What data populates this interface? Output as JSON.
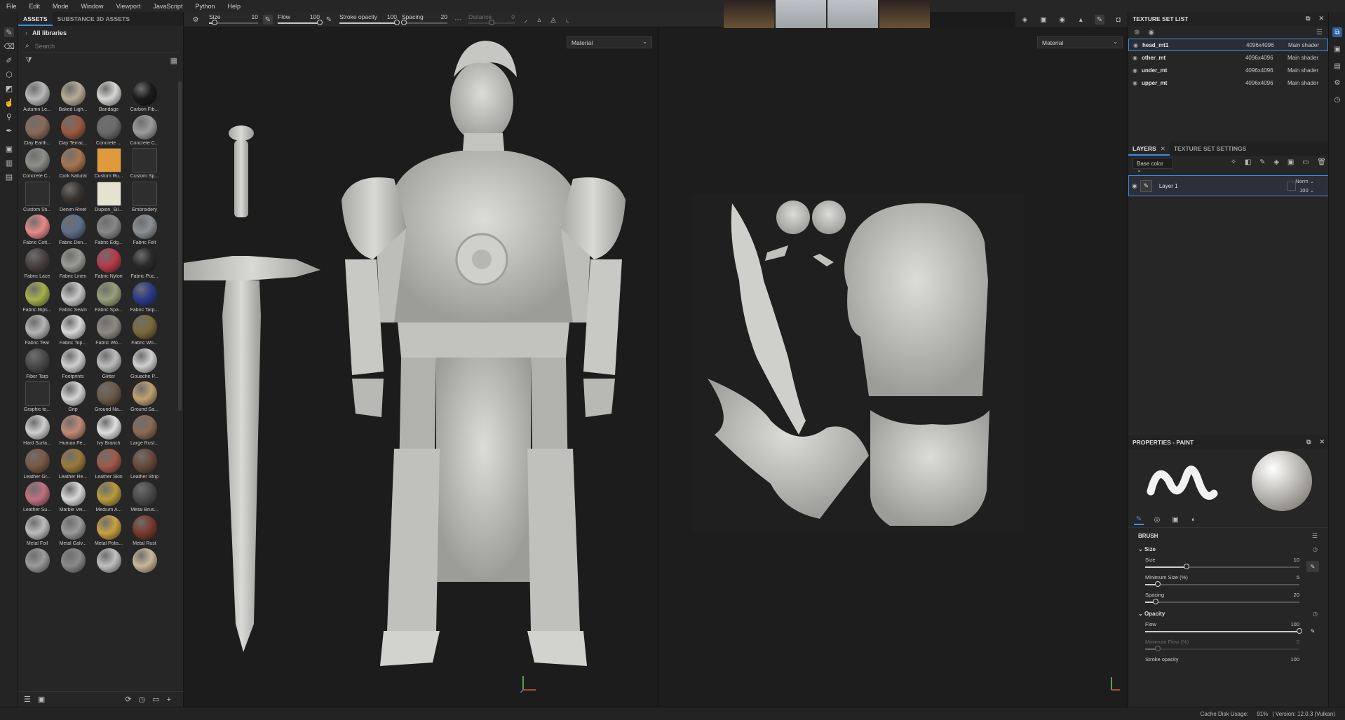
{
  "menu": [
    "File",
    "Edit",
    "Mode",
    "Window",
    "Viewport",
    "JavaScript",
    "Python",
    "Help"
  ],
  "assets": {
    "tabs": [
      "ASSETS",
      "SUBSTANCE 3D ASSETS"
    ],
    "libraries": "All libraries",
    "search_placeholder": "Search",
    "items": [
      {
        "label": "Autumn Le...",
        "color": "#b9b9b9",
        "kind": "leaf"
      },
      {
        "label": "Baked Ligh...",
        "color": "#b8ab98",
        "kind": "ball"
      },
      {
        "label": "Bandage",
        "color": "#d6d6d4",
        "kind": "ball"
      },
      {
        "label": "Carbon Fib...",
        "color": "#1a1a1a",
        "kind": "ball"
      },
      {
        "label": "Clay Earth...",
        "color": "#8a6a58",
        "kind": "ball"
      },
      {
        "label": "Clay Terrac...",
        "color": "#9a5a40",
        "kind": "ball"
      },
      {
        "label": "Concrete ...",
        "color": "#6b6b6b",
        "kind": "ball"
      },
      {
        "label": "Concrete C...",
        "color": "#9c9c9c",
        "kind": "ball"
      },
      {
        "label": "Concrete C...",
        "color": "#8e8e88",
        "kind": "ball"
      },
      {
        "label": "Cork Natural",
        "color": "#a8764f",
        "kind": "ball"
      },
      {
        "label": "Custom Ru...",
        "color": "#e09a3c",
        "kind": "tile"
      },
      {
        "label": "Custom Sp...",
        "color": "#2e2e2e",
        "kind": "tile"
      },
      {
        "label": "Custom Sti...",
        "color": "#2e2e2e",
        "kind": "tile"
      },
      {
        "label": "Denim Rivet",
        "color": "#3a3430",
        "kind": "ball"
      },
      {
        "label": "Dupion_Sil...",
        "color": "#e7e2cf",
        "kind": "tile"
      },
      {
        "label": "Embroidery",
        "color": "#2e2e2e",
        "kind": "tile"
      },
      {
        "label": "Fabric Cott...",
        "color": "#e88a8a",
        "kind": "ball"
      },
      {
        "label": "Fabric Den...",
        "color": "#5f6f88",
        "kind": "ball"
      },
      {
        "label": "Fabric Edg...",
        "color": "#888888",
        "kind": "ball"
      },
      {
        "label": "Fabric Felt",
        "color": "#8b8f96",
        "kind": "ball"
      },
      {
        "label": "Fabric Lace",
        "color": "#4a4040",
        "kind": "ball"
      },
      {
        "label": "Fabric Linen",
        "color": "#9a9a94",
        "kind": "ball"
      },
      {
        "label": "Fabric Nylon",
        "color": "#b83a4a",
        "kind": "ball"
      },
      {
        "label": "Fabric Puc...",
        "color": "#2a2a2a",
        "kind": "ball"
      },
      {
        "label": "Fabric Rips...",
        "color": "#a8b04a",
        "kind": "ball"
      },
      {
        "label": "Fabric Seam",
        "color": "#c8c8c8",
        "kind": "ball"
      },
      {
        "label": "Fabric Spa...",
        "color": "#98a07a",
        "kind": "ball"
      },
      {
        "label": "Fabric Tarp...",
        "color": "#2a3a8a",
        "kind": "ball"
      },
      {
        "label": "Fabric Tear",
        "color": "#b4b4b4",
        "kind": "ball"
      },
      {
        "label": "Fabric Top...",
        "color": "#d8d8d8",
        "kind": "ball"
      },
      {
        "label": "Fabric Wo...",
        "color": "#8e8a82",
        "kind": "ball"
      },
      {
        "label": "Fabric Wo...",
        "color": "#7a6a3a",
        "kind": "ball"
      },
      {
        "label": "Fiber Tarp",
        "color": "#4a4a4a",
        "kind": "ball"
      },
      {
        "label": "Footprints",
        "color": "#cfcfcf",
        "kind": "ball"
      },
      {
        "label": "Glitter",
        "color": "#bdbdbd",
        "kind": "ball"
      },
      {
        "label": "Gouache P...",
        "color": "#d0d0d0",
        "kind": "ball"
      },
      {
        "label": "Graphic to...",
        "color": "#2e2e2e",
        "kind": "tile"
      },
      {
        "label": "Grip",
        "color": "#d4d4d4",
        "kind": "ball"
      },
      {
        "label": "Ground Na...",
        "color": "#6a5a48",
        "kind": "ball"
      },
      {
        "label": "Ground Sa...",
        "color": "#c0a070",
        "kind": "ball"
      },
      {
        "label": "Hard Surfa...",
        "color": "#cfcfcf",
        "kind": "ball"
      },
      {
        "label": "Human Fe...",
        "color": "#c08a72",
        "kind": "ball"
      },
      {
        "label": "Ivy Branch",
        "color": "#e0e0e0",
        "kind": "ball"
      },
      {
        "label": "Large Rust...",
        "color": "#8a6a54",
        "kind": "ball"
      },
      {
        "label": "Leather Gr...",
        "color": "#7a5a44",
        "kind": "ball"
      },
      {
        "label": "Leather Re...",
        "color": "#9a7a3a",
        "kind": "ball"
      },
      {
        "label": "Leather Skin",
        "color": "#a05a48",
        "kind": "ball"
      },
      {
        "label": "Leather Strip",
        "color": "#6a4a3a",
        "kind": "ball"
      },
      {
        "label": "Leather Su...",
        "color": "#c07080",
        "kind": "ball"
      },
      {
        "label": "Marble Vei...",
        "color": "#d8d8d8",
        "kind": "ball"
      },
      {
        "label": "Medium A...",
        "color": "#b89a3a",
        "kind": "ball"
      },
      {
        "label": "Metal Brus...",
        "color": "#4a4a4a",
        "kind": "ball"
      },
      {
        "label": "Metal Foil",
        "color": "#bcbcbc",
        "kind": "ball"
      },
      {
        "label": "Metal Galv...",
        "color": "#9a9a9a",
        "kind": "ball"
      },
      {
        "label": "Metal Polis...",
        "color": "#c8a040",
        "kind": "ball"
      },
      {
        "label": "Metal Rust",
        "color": "#7a3a2a",
        "kind": "ball"
      },
      {
        "label": "",
        "color": "#9a9a9a",
        "kind": "ball"
      },
      {
        "label": "",
        "color": "#8a8a8a",
        "kind": "ball"
      },
      {
        "label": "",
        "color": "#c0c0c0",
        "kind": "ball"
      },
      {
        "label": "",
        "color": "#c8b898",
        "kind": "ball"
      }
    ]
  },
  "toolbar": {
    "size_label": "Size",
    "size_value": "10",
    "size_fraction": 0.12,
    "flow_label": "Flow",
    "flow_value": "100",
    "flow_fraction": 1.0,
    "stroke_opacity_label": "Stroke opacity",
    "stroke_opacity_value": "100",
    "stroke_opacity_fraction": 1.0,
    "spacing_label": "Spacing",
    "spacing_value": "20",
    "spacing_fraction": 0.05,
    "distance_label": "Distance",
    "distance_value": "0",
    "distance_fraction": 0.5
  },
  "viewport3d": {
    "mode": "Material"
  },
  "viewport2d": {
    "mode": "Material"
  },
  "texture_set_list": {
    "title": "TEXTURE SET LIST",
    "rows": [
      {
        "name": "head_mt1",
        "res": "4096x4096",
        "shader": "Main shader",
        "selected": true
      },
      {
        "name": "other_mt",
        "res": "4096x4096",
        "shader": "Main shader",
        "selected": false
      },
      {
        "name": "under_mt",
        "res": "4096x4096",
        "shader": "Main shader",
        "selected": false
      },
      {
        "name": "upper_mt",
        "res": "4096x4096",
        "shader": "Main shader",
        "selected": false
      }
    ]
  },
  "layers": {
    "tabs": [
      "LAYERS",
      "TEXTURE SET SETTINGS"
    ],
    "channel": "Base color",
    "layer_name": "Layer 1",
    "blend": "Norm",
    "opacity": "100"
  },
  "properties": {
    "title": "PROPERTIES - PAINT",
    "brush": "BRUSH",
    "size_section": "Size",
    "size_label": "Size",
    "size_value": "10",
    "size_fraction": 0.27,
    "min_size_label": "Minimum Size (%)",
    "min_size_value": "5",
    "min_size_fraction": 0.08,
    "spacing_label": "Spacing",
    "spacing_value": "20",
    "spacing_fraction": 0.07,
    "opacity_section": "Opacity",
    "flow_label": "Flow",
    "flow_value": "100",
    "flow_fraction": 1.0,
    "min_flow_label": "Minimum Flow (%)",
    "min_flow_value": "5",
    "min_flow_fraction": 0.08,
    "stroke_opacity_label": "Stroke opacity",
    "stroke_opacity_value": "100"
  },
  "status": {
    "cache": "Cache Disk Usage:",
    "cache_pct": "91%",
    "version": "| Version: 12.0.3 (Vulkan)"
  },
  "colors": {
    "accent": "#3d8ee8",
    "panel": "#262626",
    "viewport": "#1c1c1c"
  }
}
